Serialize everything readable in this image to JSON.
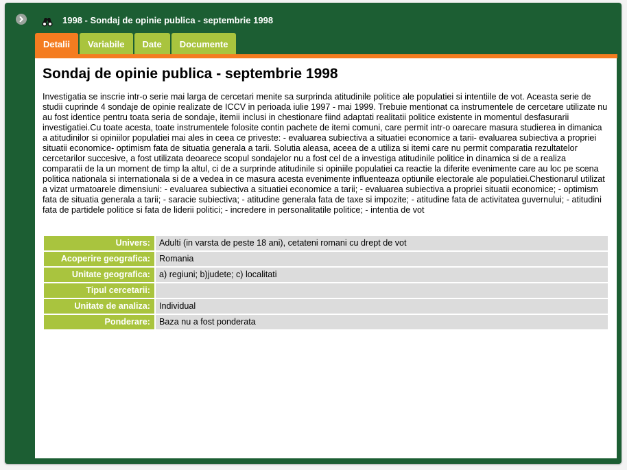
{
  "window": {
    "title": "1998 - Sondaj de opinie publica - septembrie 1998",
    "collapse_icon": "chevron-right-circle-icon",
    "title_icon": "binoculars-icon"
  },
  "colors": {
    "frame": "#1c5e33",
    "tab": "#a9c43e",
    "tab_active": "#f47c20",
    "label_cell": "#a9c43e",
    "value_cell": "#dcdcdc"
  },
  "tabs": [
    {
      "label": "Detalii",
      "active": true
    },
    {
      "label": "Variabile",
      "active": false
    },
    {
      "label": "Date",
      "active": false
    },
    {
      "label": "Documente",
      "active": false
    }
  ],
  "content": {
    "heading": "Sondaj de opinie publica - septembrie 1998",
    "description": "Investigatia se inscrie intr-o serie mai larga de cercetari menite sa surprinda atitudinile politice ale populatiei si intentiile de vot. Aceasta serie de studii cuprinde 4 sondaje de opinie realizate de ICCV in perioada iulie 1997 - mai 1999. Trebuie mentionat ca instrumentele de cercetare utilizate nu au fost identice pentru toata seria de sondaje, itemii inclusi in chestionare fiind adaptati realitatii politice existente in momentul desfasurarii investigatiei.Cu toate acesta, toate instrumentele folosite contin pachete de itemi comuni, care permit intr-o oarecare masura studierea in dimanica a atitudinilor si opiniilor populatiei mai ales in ceea ce priveste: - evaluarea subiectiva a situatiei economice a tarii- evaluarea subiectiva a propriei situatii economice- optimism fata de situatia generala a tarii. Solutia aleasa, aceea de a utiliza si itemi care nu permit comparatia rezultatelor cercetarilor succesive, a fost utilizata deoarece scopul sondajelor nu a fost cel de a investiga atitudinile politice in dinamica si de a realiza comparatii de la un moment de timp la altul, ci de a surprinde atitudinile si opiniile populatiei ca reactie la diferite evenimente care au loc pe scena politica nationala si internationala si de a vedea in ce masura acesta evenimente influenteaza optiunile electorale ale populatiei.Chestionarul utilizat a vizat urmatoarele dimensiuni: - evaluarea subiectiva a situatiei economice a tarii; - evaluarea subiectiva a propriei situatii economice; - optimism fata de situatia generala a tarii; - saracie subiectiva; - atitudine generala fata de taxe si impozite; - atitudine fata de activitatea guvernului; - atitudini fata de partidele politice si fata de liderii politici; - incredere in personalitatile politice; - intentia de vot",
    "fields": [
      {
        "label": "Univers:",
        "value": "Adulti (in varsta de peste 18 ani), cetateni romani cu drept de vot"
      },
      {
        "label": "Acoperire geografica:",
        "value": "Romania"
      },
      {
        "label": "Unitate geografica:",
        "value": "a) regiuni; b)judete; c) localitati"
      },
      {
        "label": "Tipul cercetarii:",
        "value": ""
      },
      {
        "label": "Unitate de analiza:",
        "value": "Individual"
      },
      {
        "label": "Ponderare:",
        "value": "Baza nu a fost ponderata"
      }
    ]
  }
}
